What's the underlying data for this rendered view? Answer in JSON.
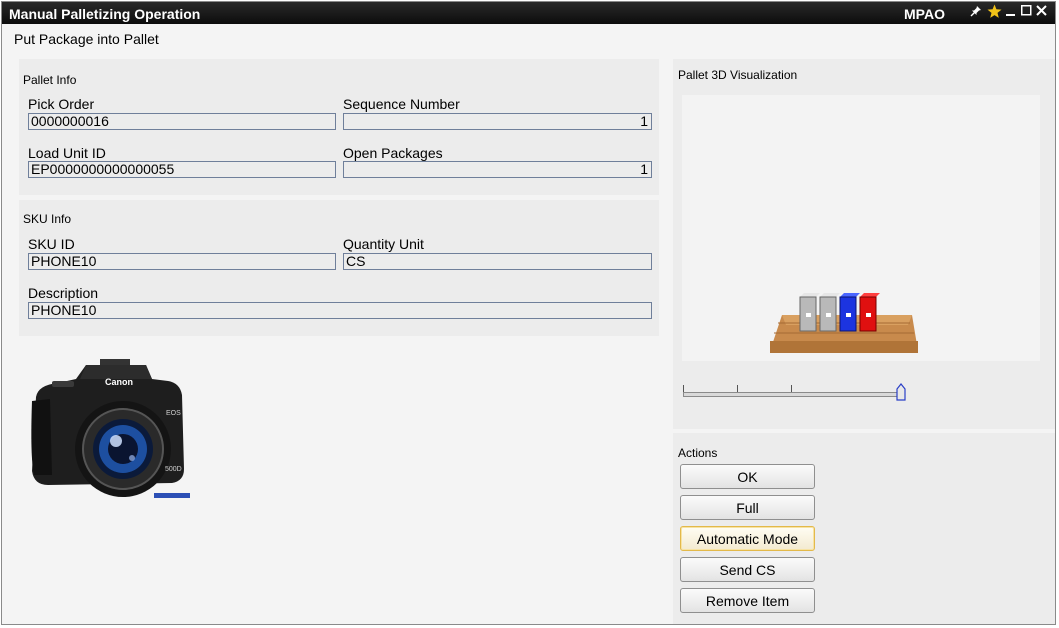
{
  "window": {
    "title": "Manual Palletizing Operation",
    "code": "MPAO",
    "icons": [
      "pin-icon",
      "star-icon",
      "minimize-icon",
      "maximize-icon",
      "close-icon"
    ]
  },
  "subtitle": "Put Package into Pallet",
  "pallet_info": {
    "title": "Pallet Info",
    "pick_order_label": "Pick Order",
    "pick_order_value": "0000000016",
    "sequence_number_label": "Sequence Number",
    "sequence_number_value": "1",
    "load_unit_id_label": "Load Unit ID",
    "load_unit_id_value": "EP0000000000000055",
    "open_packages_label": "Open Packages",
    "open_packages_value": "1"
  },
  "sku_info": {
    "title": "SKU Info",
    "sku_id_label": "SKU ID",
    "sku_id_value": "PHONE10",
    "quantity_unit_label": "Quantity Unit",
    "quantity_unit_value": "CS",
    "description_label": "Description",
    "description_value": "PHONE10"
  },
  "product_image": {
    "brand": "Canon",
    "model_mark": "EOS",
    "model_number": "500D"
  },
  "visualization": {
    "title": "Pallet 3D Visualization",
    "slider_level": 1.0
  },
  "actions": {
    "title": "Actions",
    "ok": "OK",
    "full": "Full",
    "automatic_mode": "Automatic Mode",
    "send_cs": "Send CS",
    "remove_item": "Remove Item"
  }
}
